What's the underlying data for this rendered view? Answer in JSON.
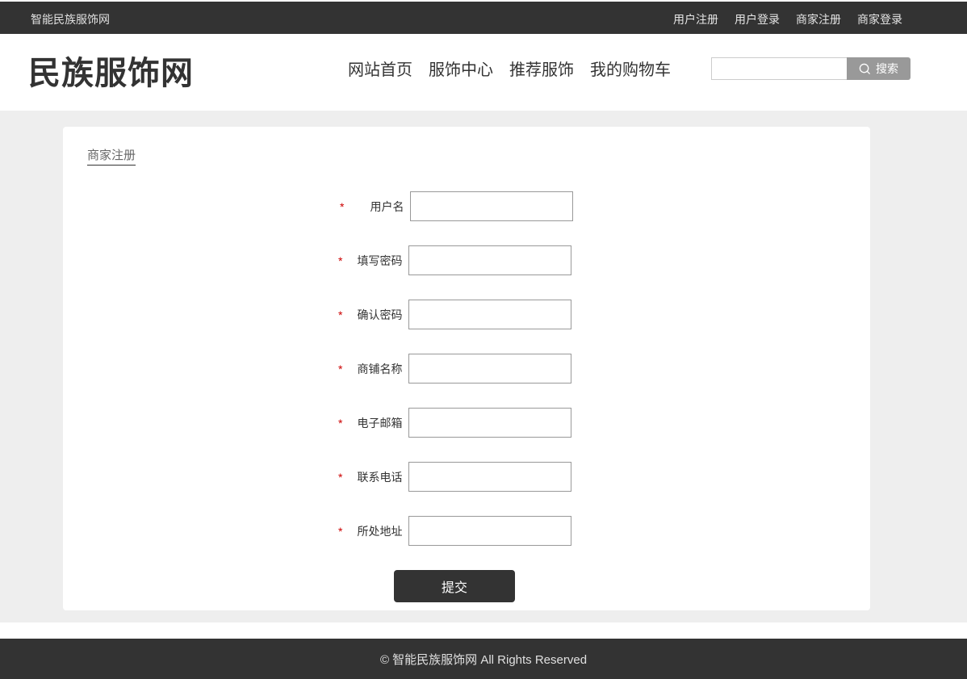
{
  "topbar": {
    "site_name": "智能民族服饰网",
    "links": [
      "用户注册",
      "用户登录",
      "商家注册",
      "商家登录"
    ]
  },
  "header": {
    "logo": "民族服饰网",
    "nav": [
      "网站首页",
      "服饰中心",
      "推荐服饰",
      "我的购物车"
    ],
    "search": {
      "placeholder": "",
      "button_label": "搜索"
    }
  },
  "page": {
    "breadcrumb": "商家注册",
    "required_mark": "*",
    "fields": [
      {
        "label": "用户名",
        "value": ""
      },
      {
        "label": "填写密码",
        "value": ""
      },
      {
        "label": "确认密码",
        "value": ""
      },
      {
        "label": "商铺名称",
        "value": ""
      },
      {
        "label": "电子邮箱",
        "value": ""
      },
      {
        "label": "联系电话",
        "value": ""
      },
      {
        "label": "所处地址",
        "value": ""
      }
    ],
    "submit_label": "提交"
  },
  "footer": {
    "text": "© 智能民族服饰网 All Rights Reserved"
  },
  "colors": {
    "dark": "#333333",
    "required": "#cc0000",
    "content_bg": "#eeeeee",
    "search_btn": "#999999"
  }
}
